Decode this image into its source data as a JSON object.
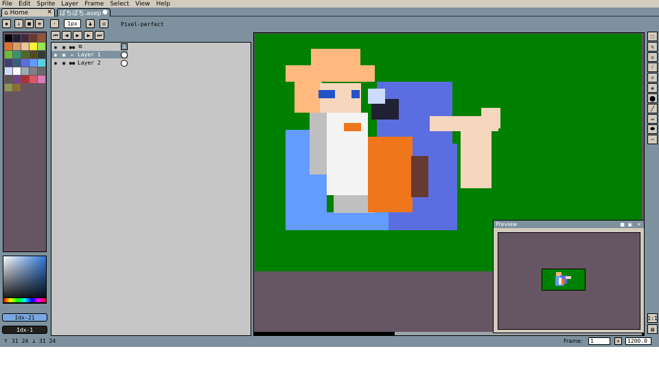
{
  "menu": [
    "File",
    "Edit",
    "Sprite",
    "Layer",
    "Frame",
    "Select",
    "View",
    "Help"
  ],
  "tabs": [
    {
      "label": "Home"
    },
    {
      "label": "ぽちぽち.asep"
    }
  ],
  "toolbar": {
    "brush_size": "1px",
    "pixel_perfect": "Pixel-perfect"
  },
  "palette": {
    "colors": [
      "#000000",
      "#222034",
      "#45283c",
      "#663931",
      "#8f563b",
      "#df7126",
      "#d9a066",
      "#eec39a",
      "#fbf236",
      "#99e550",
      "#6abe30",
      "#37946e",
      "#4b692f",
      "#524b24",
      "#323c39",
      "#3f3f74",
      "#306082",
      "#5b6ee1",
      "#639bff",
      "#5fcde4",
      "#cbdbfc",
      "#ffffff",
      "#9badb7",
      "#847e87",
      "#696a6a",
      "#595652",
      "#76428a",
      "#ac3232",
      "#d95763",
      "#d77bba",
      "#8f974a",
      "#8a6f30"
    ],
    "fg_index": "Idx-21",
    "bg_index": "Idx-1"
  },
  "layers": [
    {
      "name": "",
      "kind": "group"
    },
    {
      "name": "Layer 1",
      "kind": "layer"
    },
    {
      "name": "Layer 2",
      "kind": "layer"
    }
  ],
  "frame_number": "1",
  "preview": {
    "title": "Preview"
  },
  "status": {
    "cursor": "31 24",
    "size": "31 24",
    "frame_label": "Frame:",
    "frame_value": "1",
    "zoom": "1200.0"
  },
  "colors": {
    "canvas_bg": "#008000",
    "workspace": "#665563",
    "ui": "#7d929e",
    "panel": "#d3cbbe"
  }
}
